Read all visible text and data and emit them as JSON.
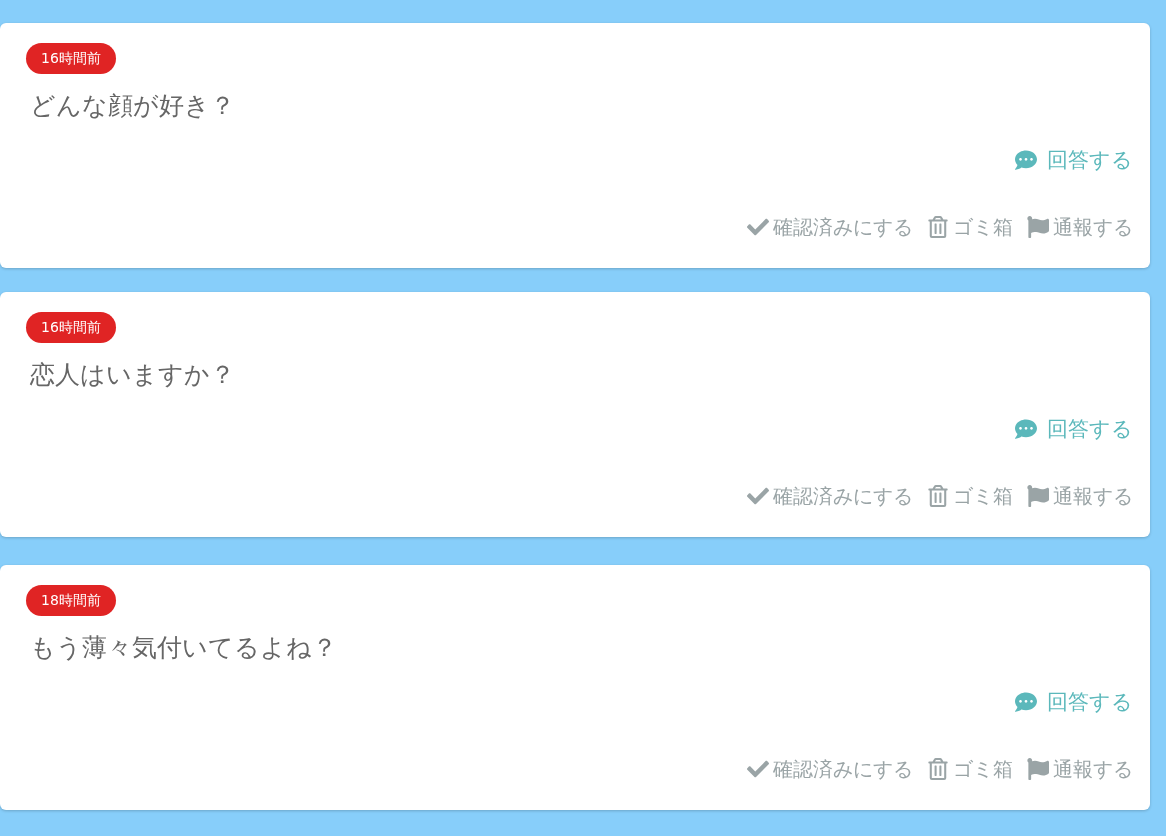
{
  "questions": [
    {
      "time": "16時間前",
      "text": "どんな顔が好き？",
      "answer": "回答する",
      "actions": [
        "確認済みにする",
        "ゴミ箱",
        "通報する"
      ]
    },
    {
      "time": "16時間前",
      "text": "恋人はいますか？",
      "answer": "回答する",
      "actions": [
        "確認済みにする",
        "ゴミ箱",
        "通報する"
      ]
    },
    {
      "time": "18時間前",
      "text": "もう薄々気付いてるよね？",
      "answer": "回答する",
      "actions": [
        "確認済みにする",
        "ゴミ箱",
        "通報する"
      ]
    }
  ]
}
